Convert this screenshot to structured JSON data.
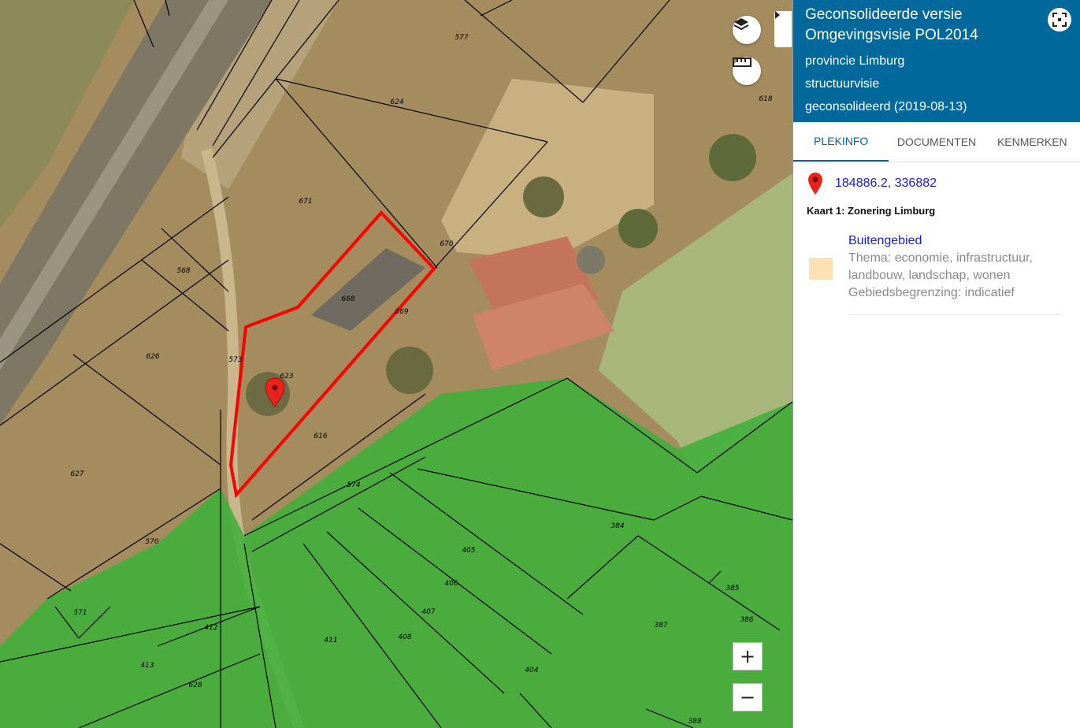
{
  "panel": {
    "title": "Geconsolideerde versie Omgevingsvisie POL2014",
    "authority": "provincie Limburg",
    "plan_type": "structuurvisie",
    "status": "geconsolideerd (2019-08-13)",
    "tabs": [
      {
        "label": "PLEKINFO",
        "active": true
      },
      {
        "label": "DOCUMENTEN",
        "active": false
      },
      {
        "label": "KENMERKEN",
        "active": false
      }
    ],
    "coordinates": "184886.2, 336882",
    "map_title": "Kaart 1: Zonering Limburg",
    "legend": {
      "name": "Buitengebied",
      "color": "#fbe1b4",
      "details": [
        "Thema: economie, infrastructuur, landbouw, landschap, wonen",
        "Gebiedsbegrenzing: indicatief"
      ]
    }
  },
  "map": {
    "controls": {
      "layers_icon": "layers-icon",
      "measure_icon": "ruler-icon",
      "zoom_in": "+",
      "zoom_out": "−"
    },
    "colors": {
      "forest_overlay": "#3fb03a",
      "selection_outline": "#ff0000",
      "header": "#01689b"
    },
    "parcel_numbers": [
      "577",
      "624",
      "618",
      "671",
      "670",
      "568",
      "668",
      "669",
      "626",
      "573",
      "623",
      "616",
      "627",
      "574",
      "384",
      "570",
      "405",
      "406",
      "571",
      "407",
      "412",
      "408",
      "411",
      "413",
      "628",
      "404",
      "385",
      "386",
      "387",
      "388"
    ]
  }
}
